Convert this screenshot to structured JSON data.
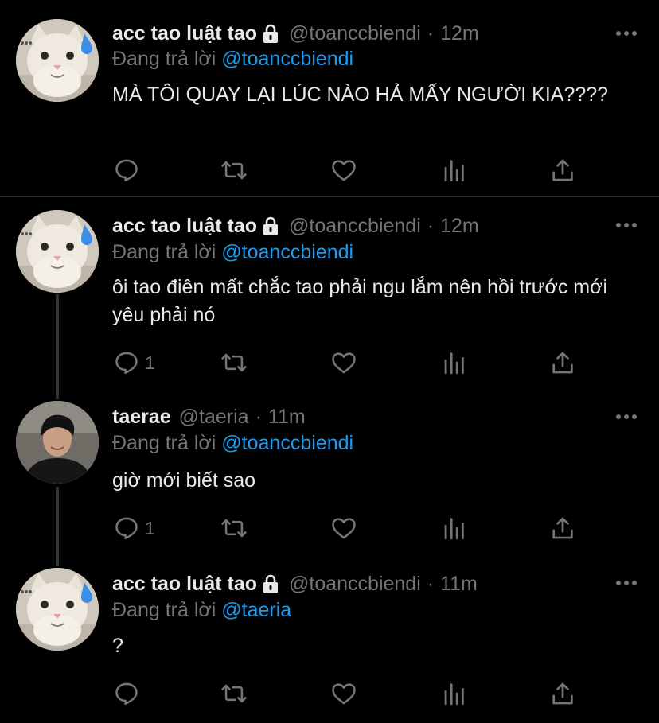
{
  "colors": {
    "background": "#000000",
    "text": "#e7e9ea",
    "secondary": "#71767b",
    "accent": "#1d9bf0",
    "divider": "#2f3336"
  },
  "tweets": [
    {
      "display_name": "acc tao luật tao",
      "handle": "@toanccbiendi",
      "separator": "·",
      "time": "12m",
      "reply_prefix": "Đang trả lời",
      "reply_to": "@toanccbiendi",
      "text": "MÀ TÔI QUAY LẠI LÚC NÀO HẢ MẤY NGƯỜI KIA????",
      "locked": true,
      "avatar": "cat-avatar",
      "reply_count": ""
    },
    {
      "display_name": "acc tao luật tao",
      "handle": "@toanccbiendi",
      "separator": "·",
      "time": "12m",
      "reply_prefix": "Đang trả lời",
      "reply_to": "@toanccbiendi",
      "text": "ôi tao điên mất chắc tao phải ngu lắm nên hồi trước mới yêu phải nó",
      "locked": true,
      "avatar": "cat-avatar",
      "reply_count": "1"
    },
    {
      "display_name": "taerae",
      "handle": "@taeria",
      "separator": "·",
      "time": "11m",
      "reply_prefix": "Đang trả lời",
      "reply_to": "@toanccbiendi",
      "text": "giờ mới biết sao",
      "locked": false,
      "avatar": "person-avatar",
      "reply_count": "1"
    },
    {
      "display_name": "acc tao luật tao",
      "handle": "@toanccbiendi",
      "separator": "·",
      "time": "11m",
      "reply_prefix": "Đang trả lời",
      "reply_to": "@taeria",
      "text": "?",
      "locked": true,
      "avatar": "cat-avatar",
      "reply_count": ""
    }
  ],
  "actions": [
    "reply-icon",
    "retweet-icon",
    "like-icon",
    "analytics-icon",
    "share-icon"
  ]
}
